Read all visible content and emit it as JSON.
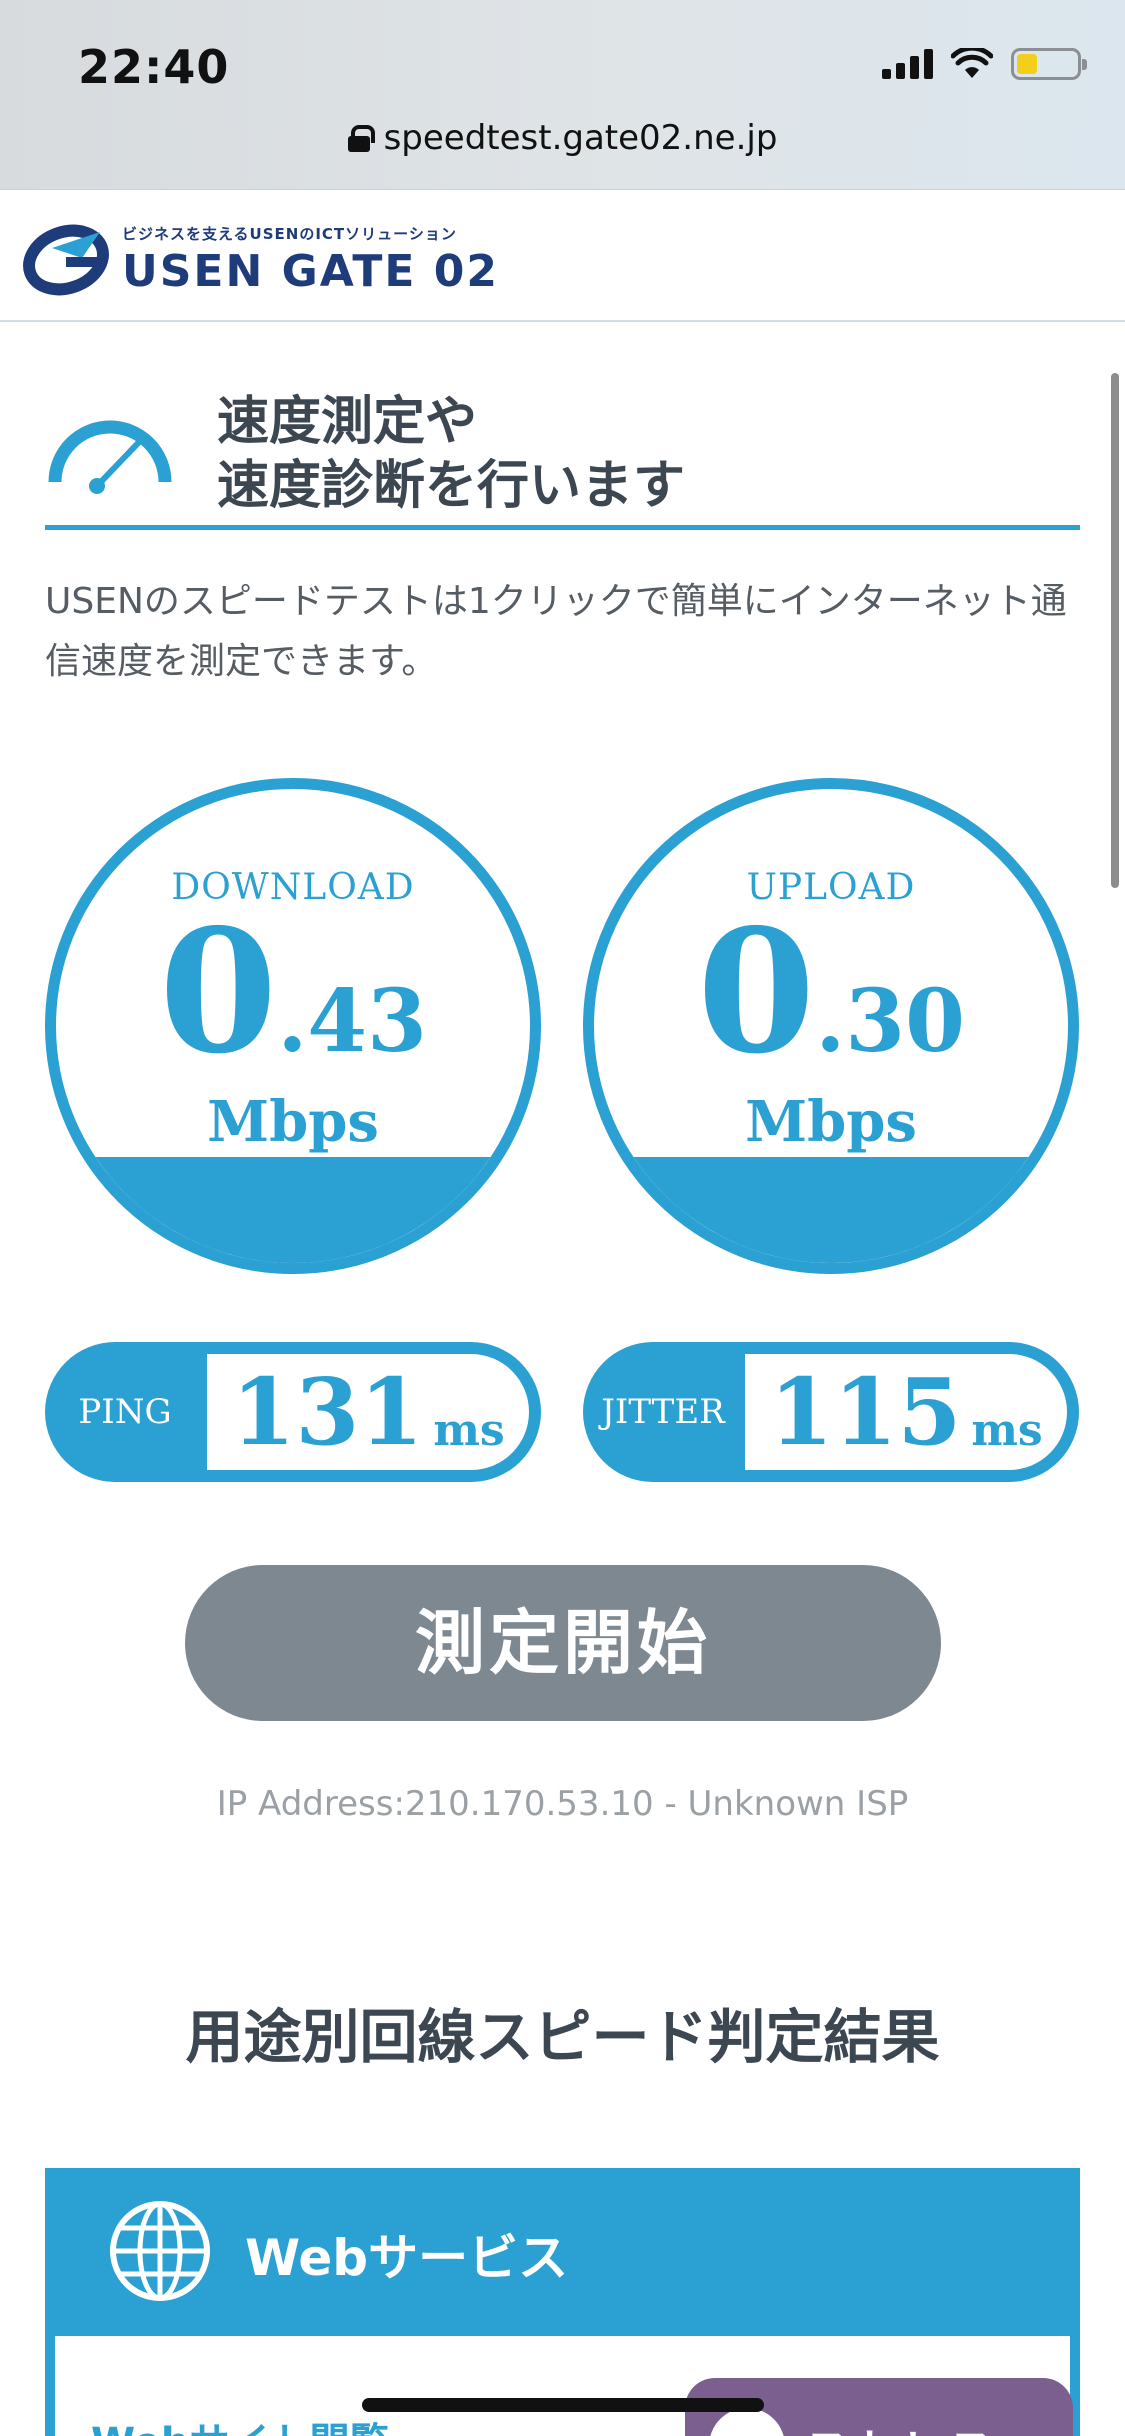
{
  "status_bar": {
    "time": "22:40"
  },
  "browser": {
    "url": "speedtest.gate02.ne.jp"
  },
  "header": {
    "logo_sub": "ビジネスを支えるUSENのICTソリューション",
    "logo_main": "USEN GATE 02"
  },
  "hero": {
    "title_line1": "速度測定や",
    "title_line2": "速度診断を行います"
  },
  "intro": "USENのスピードテストは1クリックで簡単にインターネット通信速度を測定できます。",
  "download": {
    "label": "DOWNLOAD",
    "int": "0",
    "frac": ".43",
    "unit": "Mbps"
  },
  "upload": {
    "label": "UPLOAD",
    "int": "0",
    "frac": ".30",
    "unit": "Mbps"
  },
  "ping": {
    "label": "PING",
    "value": "131",
    "unit": "ms"
  },
  "jitter": {
    "label": "JITTER",
    "value": "115",
    "unit": "ms"
  },
  "start_button": "測定開始",
  "ip_info": "IP Address:210.170.53.10 - Unknown ISP",
  "results": {
    "title": "用途別回線スピード判定結果",
    "card_title": "Webサービス",
    "item_label": "Webサイト閲覧",
    "badge_text": "ストレス"
  },
  "colors": {
    "accent": "#2ba0d2",
    "button": "#7e8891",
    "badge": "#7a5f8f"
  }
}
